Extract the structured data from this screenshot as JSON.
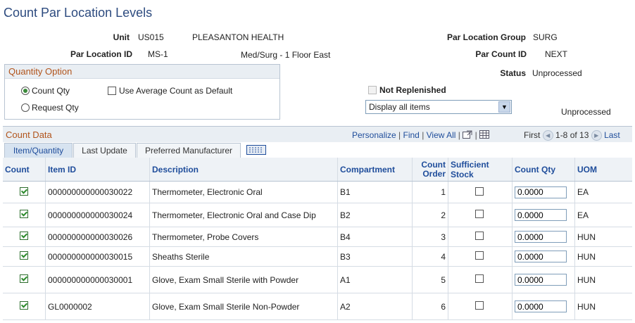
{
  "page": {
    "title": "Count Par Location Levels"
  },
  "header": {
    "unit_label": "Unit",
    "unit_value": "US015",
    "unit_desc": "PLEASANTON HEALTH",
    "par_location_label": "Par Location ID",
    "par_location_value": "MS-1",
    "par_location_desc": "Med/Surg - 1 Floor East",
    "par_group_label": "Par Location Group",
    "par_group_value": "SURG",
    "par_count_label": "Par Count ID",
    "par_count_value": "NEXT",
    "status_label": "Status",
    "status_value": "Unprocessed"
  },
  "quantity_option": {
    "title": "Quantity Option",
    "count_qty_label": "Count Qty",
    "request_qty_label": "Request Qty",
    "use_avg_label": "Use Average Count as Default",
    "selected": "count_qty"
  },
  "filters": {
    "not_replenished_label": "Not Replenished",
    "display_select_value": "Display all items",
    "unprocessed_text": "Unprocessed"
  },
  "grid": {
    "title": "Count Data",
    "personalize": "Personalize",
    "find": "Find",
    "view_all": "View All",
    "first": "First",
    "range": "1-8 of 13",
    "last": "Last",
    "tabs": [
      {
        "label": "Item/Quantity",
        "active": true
      },
      {
        "label": "Last Update",
        "active": false
      },
      {
        "label": "Preferred Manufacturer",
        "active": false
      }
    ],
    "columns": {
      "count": "Count",
      "item_id": "Item ID",
      "description": "Description",
      "compartment": "Compartment",
      "count_order": "Count Order",
      "sufficient_stock": "Sufficient Stock",
      "count_qty": "Count Qty",
      "uom": "UOM"
    },
    "rows": [
      {
        "count": true,
        "item_id": "000000000000030022",
        "description": "Thermometer, Electronic Oral",
        "compartment": "B1",
        "count_order": "1",
        "sufficient": false,
        "qty": "0.0000",
        "uom": "EA"
      },
      {
        "count": true,
        "item_id": "000000000000030024",
        "description": "Thermometer, Electronic Oral and Case Dip",
        "compartment": "B2",
        "count_order": "2",
        "sufficient": false,
        "qty": "0.0000",
        "uom": "EA"
      },
      {
        "count": true,
        "item_id": "000000000000030026",
        "description": "Thermometer, Probe Covers",
        "compartment": "B4",
        "count_order": "3",
        "sufficient": false,
        "qty": "0.0000",
        "uom": "HUN"
      },
      {
        "count": true,
        "item_id": "000000000000030015",
        "description": "Sheaths Sterile",
        "compartment": "B3",
        "count_order": "4",
        "sufficient": false,
        "qty": "0.0000",
        "uom": "HUN"
      },
      {
        "count": true,
        "item_id": "000000000000030001",
        "description": "Glove, Exam Small Sterile with Powder",
        "compartment": "A1",
        "count_order": "5",
        "sufficient": false,
        "qty": "0.0000",
        "uom": "HUN"
      },
      {
        "count": true,
        "item_id": "GL0000002",
        "description": "Glove, Exam Small Sterile Non-Powder",
        "compartment": "A2",
        "count_order": "6",
        "sufficient": false,
        "qty": "0.0000",
        "uom": "HUN"
      }
    ]
  }
}
